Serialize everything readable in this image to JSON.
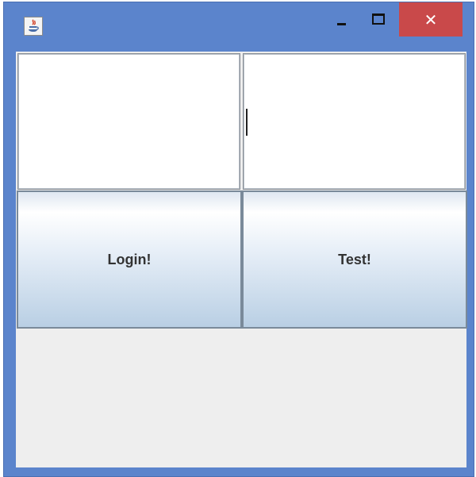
{
  "window": {
    "title": "",
    "frame_color": "#5b84cc",
    "close_color": "#c9494a",
    "app_icon": "java-icon",
    "controls": {
      "minimize_icon": "minimize-icon",
      "maximize_icon": "maximize-icon",
      "close_label": "✕"
    }
  },
  "form": {
    "left_field": {
      "value": "",
      "placeholder": ""
    },
    "right_field": {
      "value": "",
      "placeholder": ""
    },
    "buttons": {
      "login_label": "Login!",
      "test_label": "Test!"
    }
  }
}
